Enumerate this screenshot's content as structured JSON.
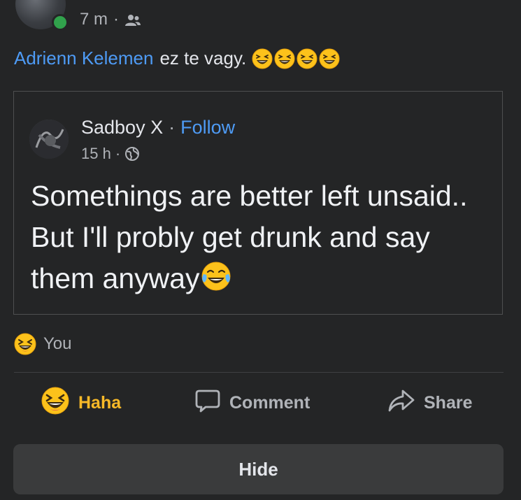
{
  "post": {
    "time": "7 m",
    "separator": "·",
    "audience_icon": "friends-icon",
    "mention": "Adrienn Kelemen",
    "text": "ez te vagy.",
    "emoji_icon": "grinning-squinting-face-emoji",
    "emoji_count": 4
  },
  "shared": {
    "author": "Sadboy X",
    "separator": "·",
    "follow_label": "Follow",
    "time": "15 h",
    "meta_separator": "·",
    "audience_icon": "globe-icon",
    "body": "Somethings are better left unsaid.. But I'll probly get drunk and say them anyway",
    "body_emoji_icon": "face-with-tears-of-joy-emoji"
  },
  "reactions": {
    "icon": "grinning-squinting-face-emoji",
    "label": "You"
  },
  "actions": {
    "haha_label": "Haha",
    "comment_label": "Comment",
    "share_label": "Share"
  },
  "hide_label": "Hide",
  "colors": {
    "background": "#242526",
    "link_blue": "#4e9bf5",
    "haha_yellow": "#f7b928",
    "secondary_text": "#b0b3b8",
    "online_green": "#31a24c",
    "button_bg": "#3a3b3c"
  }
}
